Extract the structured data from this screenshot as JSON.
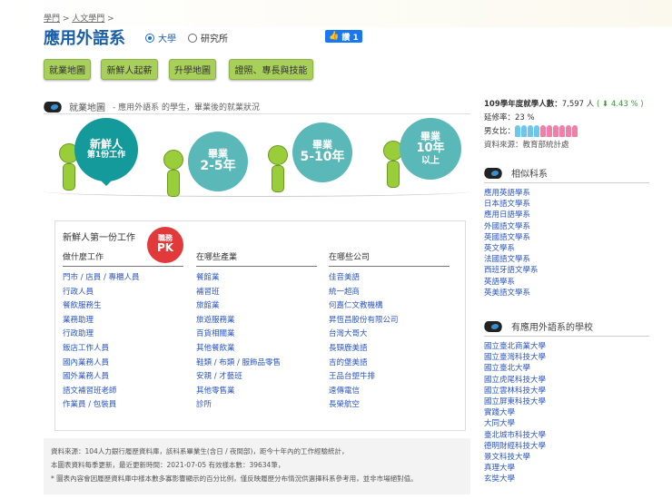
{
  "breadcrumb": [
    "學門",
    "人文學門"
  ],
  "title": "應用外語系",
  "degree_options": [
    {
      "label": "大學",
      "selected": true
    },
    {
      "label": "研究所",
      "selected": false
    }
  ],
  "like": {
    "label": "讚 1"
  },
  "tabs": [
    "就業地圖",
    "新鮮人起薪",
    "升學地圖",
    "證照、專長與技能"
  ],
  "section": {
    "title": "就業地圖",
    "subtitle": "-  應用外語系 的學生，畢業後的就業狀況"
  },
  "stages": [
    {
      "l1": "新鮮人",
      "l2": "第1份工作",
      "active": true
    },
    {
      "l1": "畢業",
      "l2": "2-5年"
    },
    {
      "l1": "畢業",
      "l2": "5-10年"
    },
    {
      "l1": "畢業",
      "l2": "10年",
      "l3": "以上"
    }
  ],
  "panel": {
    "title": "新鮮人第一份工作",
    "pk": {
      "top": "職務",
      "bottom": "PK"
    },
    "columns": [
      {
        "header": "做什麼工作",
        "items": [
          "門市 / 店員 / 專櫃人員",
          "行政人員",
          "餐飲服務生",
          "業務助理",
          "行政助理",
          "飯店工作人員",
          "國內業務人員",
          "國外業務人員",
          "語文補習班老師",
          "作業員 / 包裝員"
        ]
      },
      {
        "header": "在哪些產業",
        "items": [
          "餐館業",
          "補習班",
          "旅館業",
          "旅遊服務業",
          "百貨相關業",
          "其他餐飲業",
          "鞋類 / 布類 / 服飾品零售",
          "安親 / 才藝班",
          "其他零售業",
          "診所"
        ]
      },
      {
        "header": "在哪些公司",
        "items": [
          "佳音美語",
          "統一超商",
          "何嘉仁文教機構",
          "昇恆昌股份有限公司",
          "台灣大哥大",
          "長頸鹿美語",
          "吉的堡美語",
          "王品台塑牛排",
          "遠傳電信",
          "長榮航空"
        ]
      }
    ]
  },
  "footer": [
    "資料來源：104人力銀行履歷資料庫，該科系畢業生(含日 / 夜間部)，距今十年內的工作經驗統計，",
    "本圖表資料每季更新，最近更新時間：2021-07-05 有效樣本數：39634筆，",
    "* 圖表內容會因履歷資料庫中樣本數多寡影響顯示的百分比例，僅反映履歷分布情況供選擇科系參考用，並非市場絕對值。"
  ],
  "stats": {
    "enroll_label": "109學年度就學人數：",
    "enroll_value": "7,597 人",
    "change": "( ⬇ 4.43 % )",
    "change_color": "#3a9a3a",
    "retention": "延修率：23 %",
    "gender_label": "男女比：",
    "male_count": 4,
    "female_count": 6,
    "source": "資料來源：教育部統計處"
  },
  "similar": {
    "title": "相似科系",
    "items": [
      "應用英語學系",
      "日本語文學系",
      "應用日語學系",
      "外國語文學系",
      "英國語文學系",
      "英文學系",
      "法國語文學系",
      "西班牙語文學系",
      "英語學系",
      "英美語文學系"
    ]
  },
  "schools": {
    "title": "有應用外語系的學校",
    "items": [
      "國立臺北商業大學",
      "國立臺灣科技大學",
      "國立臺北大學",
      "國立虎尾科技大學",
      "國立雲林科技大學",
      "國立屏東科技大學",
      "實踐大學",
      "大同大學",
      "臺北城市科技大學",
      "德明財經科技大學",
      "景文科技大學",
      "真理大學",
      "玄奘大學"
    ]
  }
}
